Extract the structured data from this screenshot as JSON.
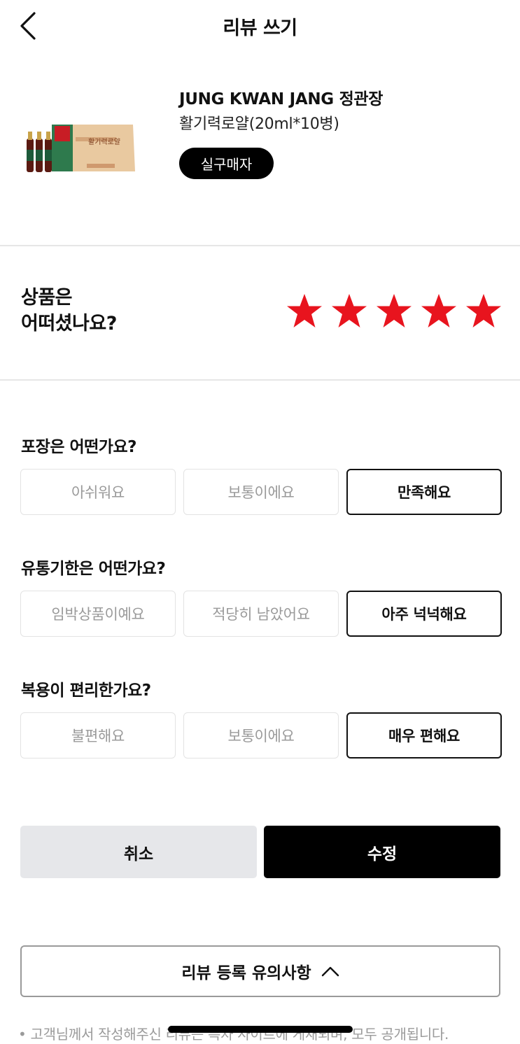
{
  "header": {
    "title": "리뷰 쓰기",
    "back_icon": "chevron-left-icon"
  },
  "product": {
    "brand": "JUNG KWAN JANG 정관장",
    "name": "활기력로얄(20ml*10병)",
    "badge": "실구매자",
    "image_box_text": "활기력로얄"
  },
  "rating": {
    "question_line1": "상품은",
    "question_line2": "어떠셨나요?",
    "stars_selected": 5,
    "stars_total": 5,
    "star_color": "#e8141e"
  },
  "questions": [
    {
      "title": "포장은 어떤가요?",
      "options": [
        "아쉬워요",
        "보통이에요",
        "만족해요"
      ],
      "selected_index": 2
    },
    {
      "title": "유통기한은 어떤가요?",
      "options": [
        "임박상품이예요",
        "적당히 남았어요",
        "아주 넉넉해요"
      ],
      "selected_index": 2
    },
    {
      "title": "복용이 편리한가요?",
      "options": [
        "불편해요",
        "보통이에요",
        "매우 편해요"
      ],
      "selected_index": 2
    }
  ],
  "actions": {
    "cancel_label": "취소",
    "edit_label": "수정"
  },
  "notice": {
    "button_label": "리뷰 등록 유의사항",
    "toggle_icon": "chevron-up-icon",
    "text": "• 고객님께서 작성해주신 리뷰는 특차 사이트에 게재되며, 모두 공개됩니다."
  },
  "colors": {
    "accent_dark": "#000000",
    "star": "#e8141e",
    "cancel_bg": "#e6e7ea",
    "muted_text": "#9a9a9a"
  }
}
